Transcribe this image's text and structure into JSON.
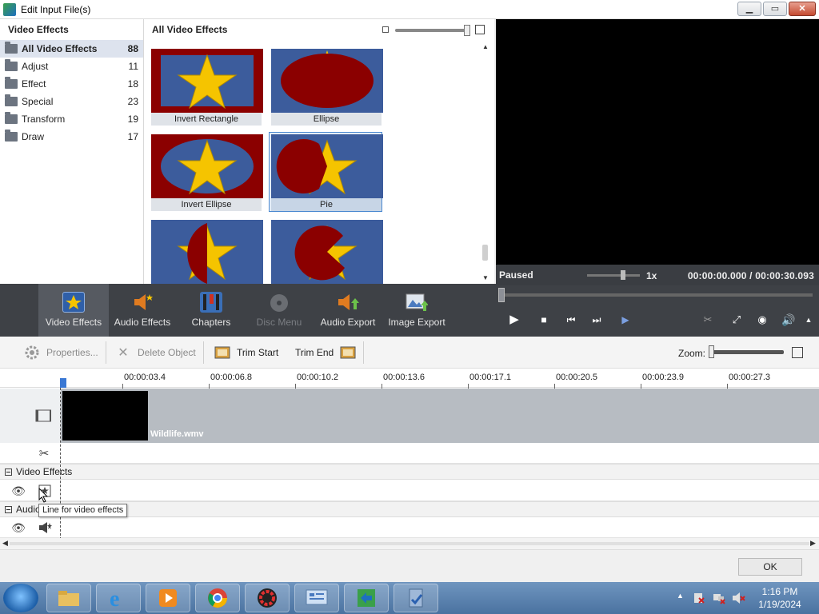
{
  "window": {
    "title": "Edit Input File(s)",
    "minimize": "▁",
    "maximize": "▭",
    "close": "✕"
  },
  "categories": {
    "header": "Video Effects",
    "items": [
      {
        "label": "All Video Effects",
        "count": "88"
      },
      {
        "label": "Adjust",
        "count": "11"
      },
      {
        "label": "Effect",
        "count": "18"
      },
      {
        "label": "Special",
        "count": "23"
      },
      {
        "label": "Transform",
        "count": "19"
      },
      {
        "label": "Draw",
        "count": "17"
      }
    ]
  },
  "effects": {
    "header": "All Video Effects",
    "items": [
      {
        "label": "Invert Rectangle"
      },
      {
        "label": "Ellipse"
      },
      {
        "label": "Invert Ellipse"
      },
      {
        "label": "Pie"
      },
      {
        "label": ""
      },
      {
        "label": ""
      }
    ]
  },
  "preview": {
    "status": "Paused",
    "speed": "1x",
    "time": "00:00:00.000 / 00:00:30.093"
  },
  "toolbar": {
    "video_effects": "Video Effects",
    "audio_effects": "Audio Effects",
    "chapters": "Chapters",
    "disc_menu": "Disc Menu",
    "audio_export": "Audio Export",
    "image_export": "Image Export"
  },
  "edit": {
    "properties": "Properties...",
    "delete_object": "Delete Object",
    "trim_start": "Trim Start",
    "trim_end": "Trim End",
    "zoom": "Zoom:"
  },
  "timeline": {
    "ticks": [
      "00:00:03.4",
      "00:00:06.8",
      "00:00:10.2",
      "00:00:13.6",
      "00:00:17.1",
      "00:00:20.5",
      "00:00:23.9",
      "00:00:27.3"
    ],
    "clip_name": "Wildlife.wmv",
    "video_effects_header": "Video Effects",
    "audio_header": "Audio",
    "tooltip": "Line for video effects"
  },
  "footer": {
    "ok": "OK"
  },
  "taskbar": {
    "time": "1:16 PM",
    "date": "1/19/2024"
  },
  "colors": {
    "accent": "#3a78d4",
    "toolbar_bg": "#3e4146",
    "effect_red": "#8b0000",
    "effect_yellow": "#f5c400"
  }
}
